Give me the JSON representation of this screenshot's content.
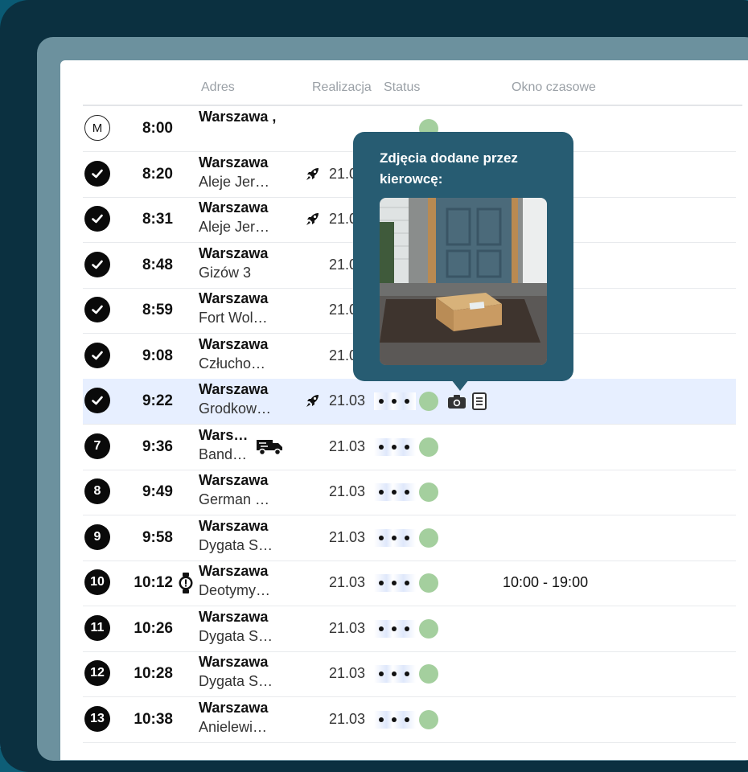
{
  "columns": {
    "address": "Adres",
    "realization": "Realizacja",
    "status": "Status",
    "time_window": "Okno czasowe"
  },
  "popup": {
    "title": "Zdjęcia dodane przez kierowcę:",
    "photo_icon": "parcel-at-door-photo"
  },
  "colors": {
    "popup_bg": "#275c72",
    "status_green": "#a4cf9e",
    "selected_row": "#e7efff"
  },
  "rows": [
    {
      "badge": "M",
      "time": "8:00",
      "city": "Warszawa ,",
      "address": "",
      "date": "",
      "type": "start"
    },
    {
      "badge": "check",
      "time": "8:20",
      "city": "Warszawa",
      "address": "Aleje Jer…",
      "date": "21.0",
      "rocket": true
    },
    {
      "badge": "check",
      "time": "8:31",
      "city": "Warszawa",
      "address": "Aleje Jer…",
      "date": "21.0",
      "rocket": true
    },
    {
      "badge": "check",
      "time": "8:48",
      "city": "Warszawa",
      "address": "Gizów 3",
      "date": "21.0"
    },
    {
      "badge": "check",
      "time": "8:59",
      "city": "Warszawa",
      "address": "Fort Wol…",
      "date": "21.0"
    },
    {
      "badge": "check",
      "time": "9:08",
      "city": "Warszawa",
      "address": "Człucho…",
      "date": "21.0"
    },
    {
      "badge": "check",
      "time": "9:22",
      "city": "Warszawa",
      "address": "Grodkow…",
      "date": "21.03",
      "rocket": true,
      "selected": true,
      "camera": true,
      "document": true
    },
    {
      "badge": "7",
      "time": "9:36",
      "city": "Wars…",
      "address": "Band…",
      "date": "21.03",
      "truck": true
    },
    {
      "badge": "8",
      "time": "9:49",
      "city": "Warszawa",
      "address": "German …",
      "date": "21.03"
    },
    {
      "badge": "9",
      "time": "9:58",
      "city": "Warszawa",
      "address": "Dygata S…",
      "date": "21.03"
    },
    {
      "badge": "10",
      "time": "10:12",
      "city": "Warszawa",
      "address": "Deotymy…",
      "date": "21.03",
      "watch": true,
      "window": "10:00 - 19:00"
    },
    {
      "badge": "11",
      "time": "10:26",
      "city": "Warszawa",
      "address": "Dygata S…",
      "date": "21.03"
    },
    {
      "badge": "12",
      "time": "10:28",
      "city": "Warszawa",
      "address": "Dygata S…",
      "date": "21.03"
    },
    {
      "badge": "13",
      "time": "10:38",
      "city": "Warszawa",
      "address": "Anielewi…",
      "date": "21.03"
    }
  ]
}
